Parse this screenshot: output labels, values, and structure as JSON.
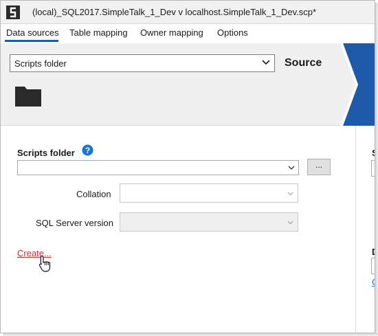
{
  "window": {
    "title": "(local)_SQL2017.SimpleTalk_1_Dev v localhost.SimpleTalk_1_Dev.scp*"
  },
  "tabs": [
    {
      "label": "Data sources",
      "active": true
    },
    {
      "label": "Table mapping",
      "active": false
    },
    {
      "label": "Owner mapping",
      "active": false
    },
    {
      "label": "Options",
      "active": false
    }
  ],
  "source_panel": {
    "source_type_selected": "Scripts folder",
    "heading": "Source",
    "arrow_color": "#1e5aa8"
  },
  "form": {
    "scripts_folder_label": "Scripts folder",
    "scripts_folder_value": "",
    "browse_label": "...",
    "collation_label": "Collation",
    "collation_value": "",
    "sql_version_label": "SQL Server version",
    "sql_version_value": "",
    "create_link": "Create..."
  },
  "target_peek": {
    "partial_label_1": "S",
    "partial_label_2": "D",
    "partial_link": "C"
  },
  "colors": {
    "accent": "#1e5aa8",
    "link_red": "#d62c2c",
    "help_blue": "#1a73d9"
  }
}
